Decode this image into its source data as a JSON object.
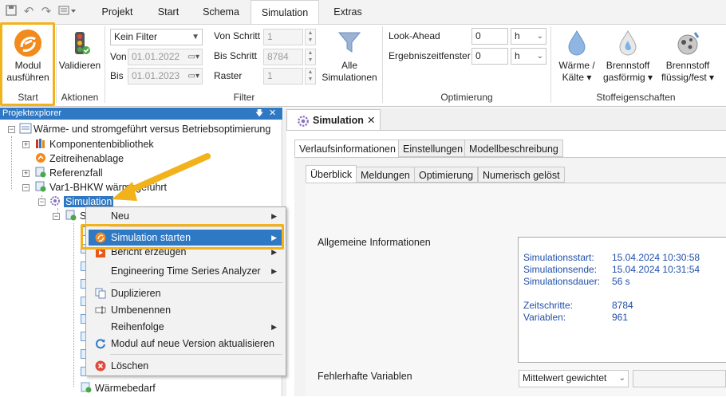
{
  "ribbon_tabs": [
    "Projekt",
    "Start",
    "Schema",
    "Simulation",
    "Extras"
  ],
  "active_tab": "Simulation",
  "ribbon": {
    "start_group": {
      "button_line1": "Modul",
      "button_line2": "ausführen",
      "label": "Start"
    },
    "aktionen_group": {
      "button": "Validieren",
      "label": "Aktionen"
    },
    "filter_group": {
      "filter_select": "Kein Filter",
      "von_label": "Von",
      "von_value": "01.01.2022",
      "bis_label": "Bis",
      "bis_value": "01.01.2023",
      "von_schritt_label": "Von Schritt",
      "von_schritt_value": "1",
      "bis_schritt_label": "Bis Schritt",
      "bis_schritt_value": "8784",
      "raster_label": "Raster",
      "raster_value": "1",
      "alle_line1": "Alle",
      "alle_line2": "Simulationen",
      "label": "Filter"
    },
    "optimierung_group": {
      "lookahead_label": "Look-Ahead",
      "lookahead_value": "0",
      "lookahead_unit": "h",
      "ezf_label": "Ergebniszeitfenster",
      "ezf_value": "0",
      "ezf_unit": "h",
      "label": "Optimierung"
    },
    "stoff_group": {
      "b1_line1": "Wärme /",
      "b1_line2": "Kälte",
      "b2_line1": "Brennstoff",
      "b2_line2": "gasförmig",
      "b3_line1": "Brennstoff",
      "b3_line2": "flüssig/fest",
      "label": "Stoffeigenschaften"
    }
  },
  "explorer": {
    "title": "Projektexplorer",
    "pin_glyph": "🡇",
    "close_glyph": "✕",
    "items": [
      "Wärme- und stromgeführt versus Betriebsoptimierung",
      "Komponentenbibliothek",
      "Zeitreihenablage",
      "Referenzfall",
      "Var1-BHKW wärmegeführt",
      "Simulation",
      "Sc",
      "Wärmebedarf"
    ]
  },
  "context_menu": {
    "items": [
      {
        "label": "Neu",
        "submenu": true
      },
      {
        "label": "Simulation starten",
        "submenu": true
      },
      {
        "label": "Bericht erzeugen",
        "submenu": true
      },
      {
        "label": "Engineering Time Series Analyzer",
        "submenu": true
      },
      {
        "label": "Duplizieren",
        "submenu": false
      },
      {
        "label": "Umbenennen",
        "submenu": false
      },
      {
        "label": "Reihenfolge",
        "submenu": true
      },
      {
        "label": "Modul auf neue Version aktualisieren",
        "submenu": false
      },
      {
        "label": "Löschen",
        "submenu": false
      }
    ]
  },
  "document": {
    "tab_title": "Simulation",
    "close_glyph": "✕",
    "main_tabs": [
      "Verlaufsinformationen",
      "Einstellungen",
      "Modellbeschreibung"
    ],
    "sub_tabs": [
      "Überblick",
      "Meldungen",
      "Optimierung",
      "Numerisch gelöst"
    ],
    "general_info_label": "Allgemeine Informationen",
    "info": {
      "start_key": "Simulationsstart:",
      "start_val": "15.04.2024 10:30:58",
      "end_key": "Simulationsende:",
      "end_val": "15.04.2024 10:31:54",
      "duration_key": "Simulationsdauer:",
      "duration_val": "56 s",
      "steps_key": "Zeitschritte:",
      "steps_val": "8784",
      "vars_key": "Variablen:",
      "vars_val": "961"
    },
    "faulty_label": "Fehlerhafte Variablen",
    "faulty_select": "Mittelwert gewichtet"
  },
  "colors": {
    "accent": "#2f78c4",
    "highlight": "#f2b21c",
    "info_text": "#1f4fa8"
  }
}
